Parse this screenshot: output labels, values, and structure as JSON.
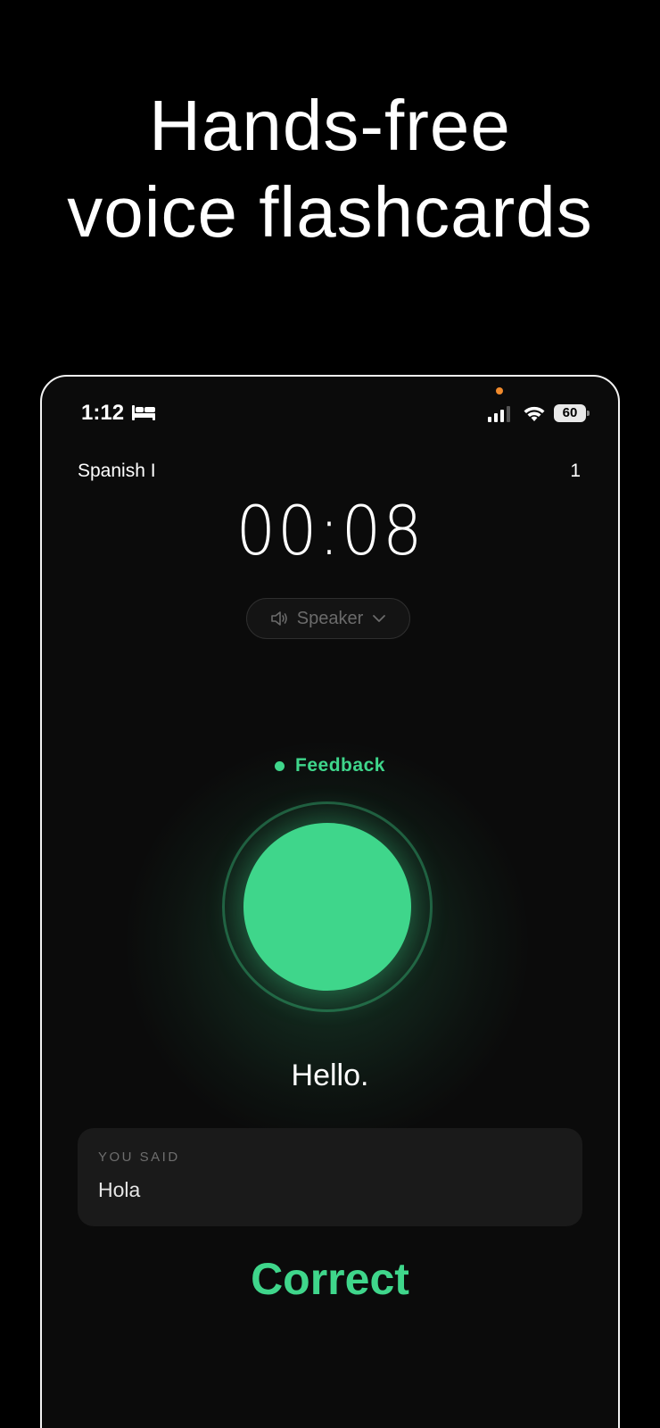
{
  "headline": {
    "line1": "Hands-free",
    "line2": "voice flashcards"
  },
  "status_bar": {
    "time": "1:12",
    "battery": "60",
    "icons": [
      "bed-icon",
      "signal-icon",
      "wifi-icon",
      "battery-icon"
    ]
  },
  "session": {
    "deck_name": "Spanish I",
    "card_count": "1",
    "timer": "00:08"
  },
  "audio_output": {
    "label": "Speaker",
    "icon": "speaker-icon"
  },
  "state": {
    "label": "Feedback",
    "color": "#3fd68b"
  },
  "card": {
    "prompt": "Hello."
  },
  "answer": {
    "label": "YOU SAID",
    "value": "Hola"
  },
  "result": {
    "label": "Correct",
    "color": "#3fd68b"
  }
}
